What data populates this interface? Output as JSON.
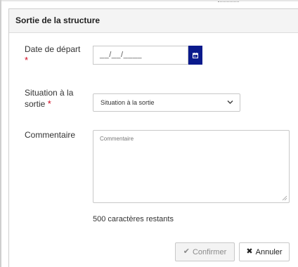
{
  "modal": {
    "title": "Sortie de la structure"
  },
  "form": {
    "date": {
      "label": "Date de départ",
      "required_mark": "*",
      "value": "__/__/____",
      "calendar_icon": "calendar-icon"
    },
    "situation": {
      "label_line1": "Situation à la",
      "label_line2": "sortie",
      "required_mark": "*",
      "selected": "Situation à la sortie",
      "chevron_icon": "chevron-down-icon"
    },
    "comment": {
      "label": "Commentaire",
      "placeholder": "Commentaire",
      "remaining": "500 caractères restants"
    }
  },
  "actions": {
    "confirm_label": "Confirmer",
    "confirm_icon": "check-icon",
    "cancel_label": "Annuler",
    "cancel_icon": "close-icon"
  },
  "colors": {
    "calendar_button": "#0a1a8c",
    "required": "#d0021b",
    "header_bg": "#f4f4f4"
  }
}
